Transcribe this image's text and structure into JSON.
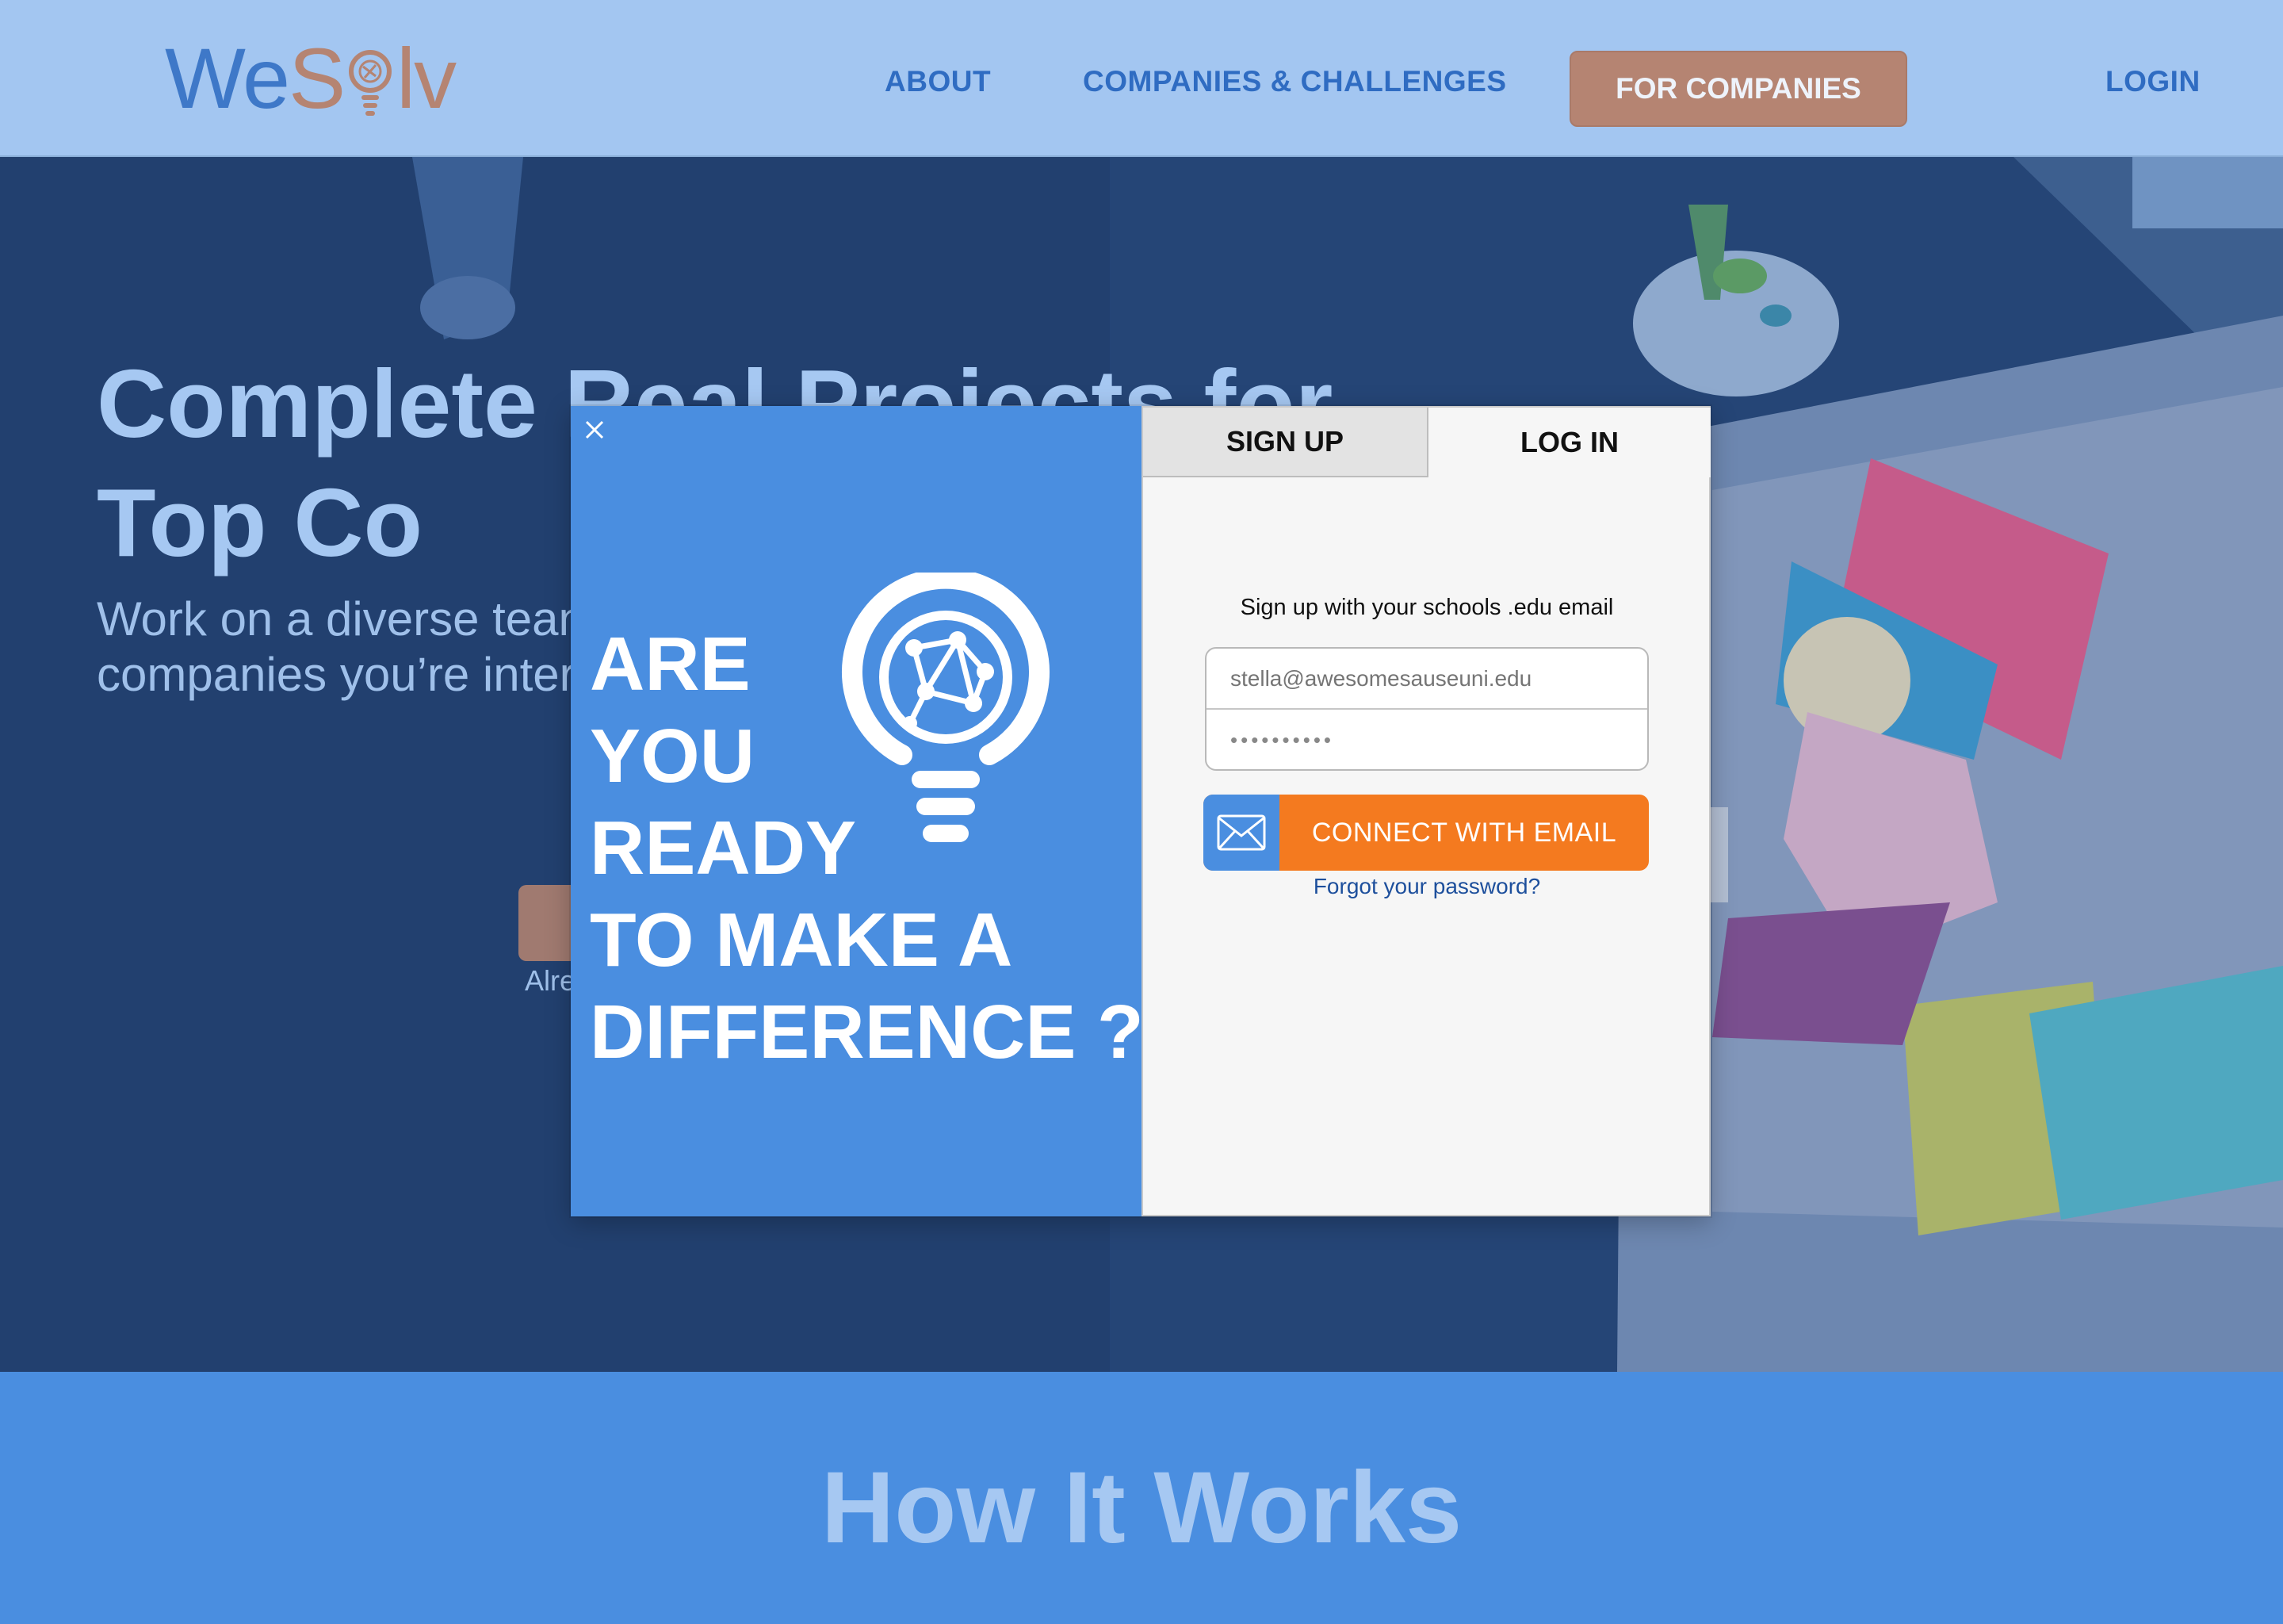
{
  "brand": {
    "logo_we": "We",
    "logo_solv": "S lv"
  },
  "nav": {
    "about": "ABOUT",
    "companies_challenges": "COMPANIES & CHALLENGES",
    "for_companies": "FOR COMPANIES",
    "login": "LOGIN"
  },
  "hero": {
    "title": "Complete Real Projects for Top Co",
    "subtitle": "Work on a diverse tean challenges to solve rea companies you’re inter experience, win cash a",
    "already": "Alre"
  },
  "how": {
    "title": "How It Works"
  },
  "modal": {
    "headline": [
      "ARE",
      "YOU",
      "READY",
      "TO MAKE A",
      "DIFFERENCE ?"
    ],
    "tabs": {
      "signup": "SIGN UP",
      "login": "LOG IN"
    },
    "hint": "Sign up with your schools .edu email",
    "email_placeholder": "stella@awesomesauseuni.edu",
    "password_value": "••••••••••",
    "connect_label": "CONNECT WITH EMAIL",
    "forgot_label": "Forgot your password?"
  },
  "colors": {
    "header_bg": "#a3c6f1",
    "brand_blue": "#3e78c8",
    "brand_copper": "#b58472",
    "modal_blue": "#4a8ee0",
    "cta_orange": "#f47a1f"
  },
  "icons": [
    "close-icon",
    "lightbulb-network-icon",
    "envelope-icon"
  ]
}
